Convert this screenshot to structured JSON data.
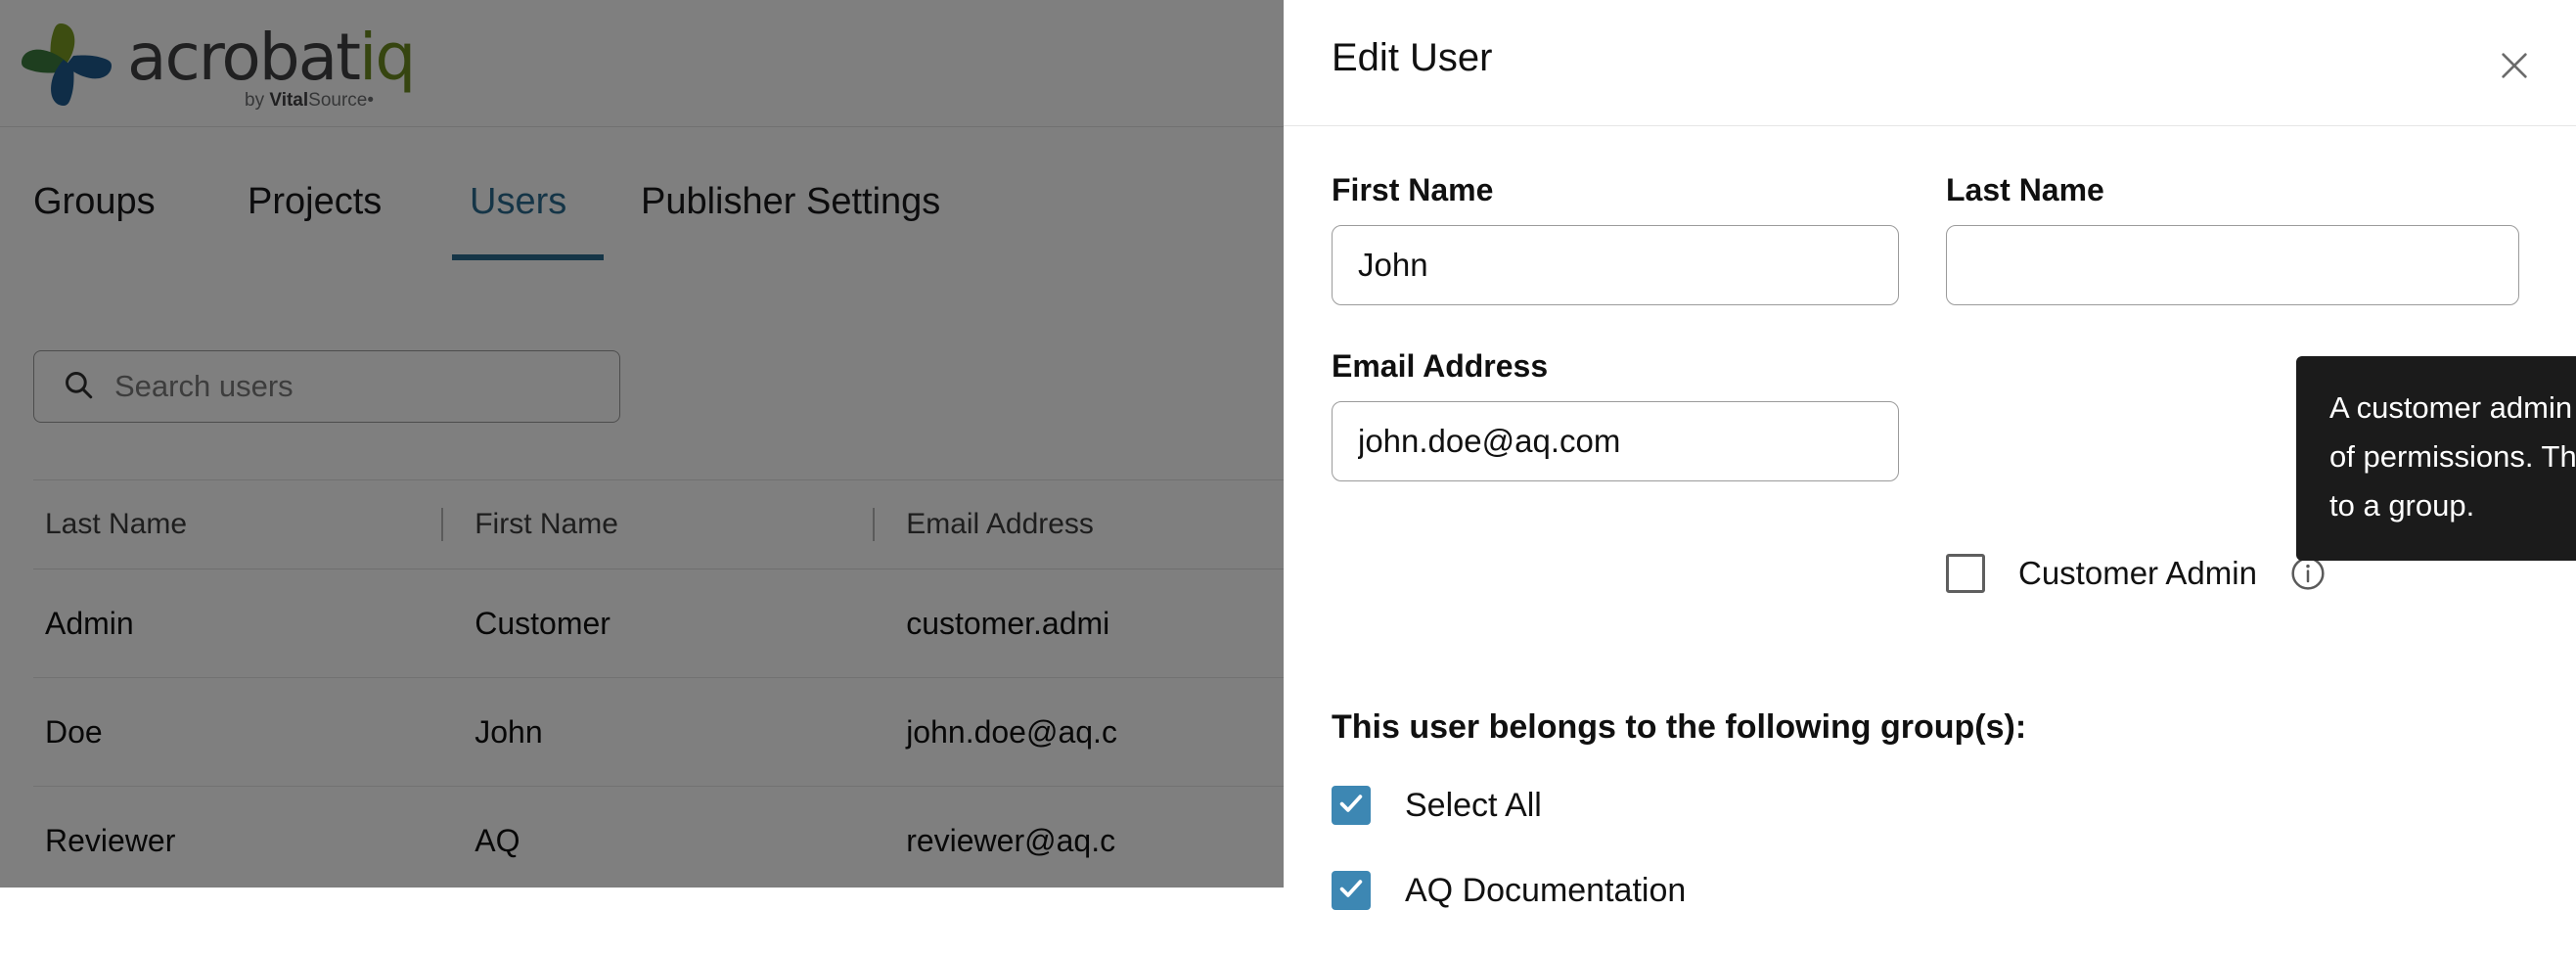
{
  "background": {
    "brand": {
      "name": "acrobatiq",
      "name_prefix": "acrobat",
      "name_suffix": "iq",
      "byline_prefix": "by ",
      "byline_brand": "Vital",
      "byline_rest": "Source",
      "colors": {
        "green": "#6d8b21",
        "dark_green": "#3c7d3f",
        "blue": "#1f5b8f",
        "word": "#414042"
      }
    },
    "tabs": [
      {
        "label": "Groups",
        "active": false
      },
      {
        "label": "Projects",
        "active": false
      },
      {
        "label": "Users",
        "active": true
      },
      {
        "label": "Publisher Settings",
        "active": false
      }
    ],
    "search": {
      "placeholder": "Search users",
      "icon": "search-icon",
      "value": ""
    },
    "table": {
      "columns": [
        "Last Name",
        "First Name",
        "Email Address"
      ],
      "rows": [
        {
          "last_name": "Admin",
          "first_name": "Customer",
          "email": "customer.admi"
        },
        {
          "last_name": "Doe",
          "first_name": "John",
          "email": "john.doe@aq.c"
        },
        {
          "last_name": "Reviewer",
          "first_name": "AQ",
          "email": "reviewer@aq.c"
        }
      ]
    }
  },
  "modal": {
    "title": "Edit User",
    "close_icon": "close-icon",
    "fields": {
      "first_name_label": "First Name",
      "first_name_value": "John",
      "last_name_label": "Last Name",
      "last_name_value": "",
      "email_label": "Email Address",
      "email_value": "john.doe@aq.com"
    },
    "customer_admin": {
      "label": "Customer Admin",
      "checked": false,
      "info_icon": "info-icon"
    },
    "tooltip": {
      "text": "A customer admin has the highest level of permissions. They cannot be added to a group.",
      "background": "#1b1b1b",
      "color": "#ffffff"
    },
    "groups": {
      "title": "This user belongs to the following group(s):",
      "items": [
        {
          "label": "Select All",
          "checked": true
        },
        {
          "label": "AQ Documentation",
          "checked": true
        }
      ],
      "checkbox_color": "#3d87b3"
    }
  }
}
